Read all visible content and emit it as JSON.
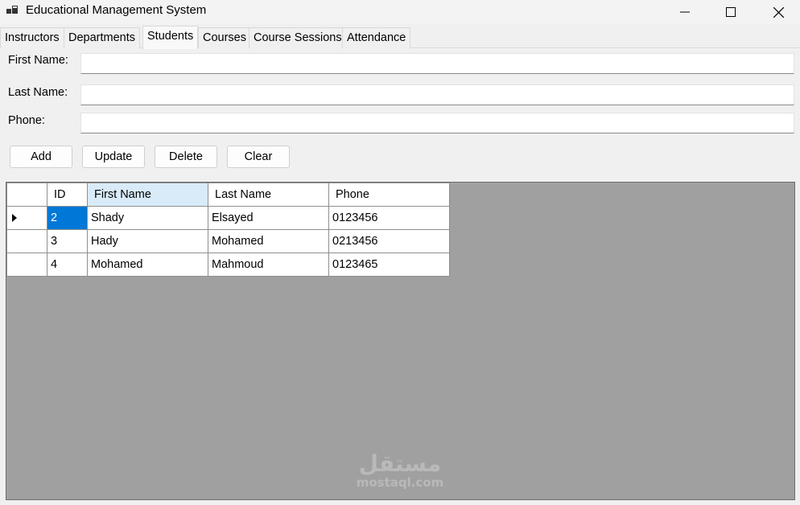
{
  "window": {
    "title": "Educational Management System",
    "app_icon": "windows-form-icon",
    "controls": [
      "minimize-icon",
      "maximize-icon",
      "close-icon"
    ]
  },
  "tabs": [
    {
      "label": "Instructors",
      "active": false
    },
    {
      "label": "Departments",
      "active": false
    },
    {
      "label": "Students",
      "active": true
    },
    {
      "label": "Courses",
      "active": false
    },
    {
      "label": "Course Sessions",
      "active": false
    },
    {
      "label": "Attendance",
      "active": false
    }
  ],
  "form": {
    "first_name_label": "First Name:",
    "first_name_value": "",
    "last_name_label": "Last Name:",
    "last_name_value": "",
    "phone_label": "Phone:",
    "phone_value": ""
  },
  "buttons": {
    "add": "Add",
    "update": "Update",
    "delete": "Delete",
    "clear": "Clear"
  },
  "grid": {
    "columns": [
      "ID",
      "First Name",
      "Last Name",
      "Phone"
    ],
    "sorted_column": "First Name",
    "current_row_icon": "row-pointer-icon",
    "rows": [
      {
        "id": "2",
        "first_name": "Shady",
        "last_name": "Elsayed",
        "phone": "0123456",
        "current": true
      },
      {
        "id": "3",
        "first_name": "Hady",
        "last_name": "Mohamed",
        "phone": "0213456",
        "current": false
      },
      {
        "id": "4",
        "first_name": "Mohamed",
        "last_name": "Mahmoud",
        "phone": "0123465",
        "current": false
      }
    ],
    "selection_color": "#0078d7"
  },
  "watermark": {
    "arabic": "مستقل",
    "latin": "mostaql.com"
  }
}
